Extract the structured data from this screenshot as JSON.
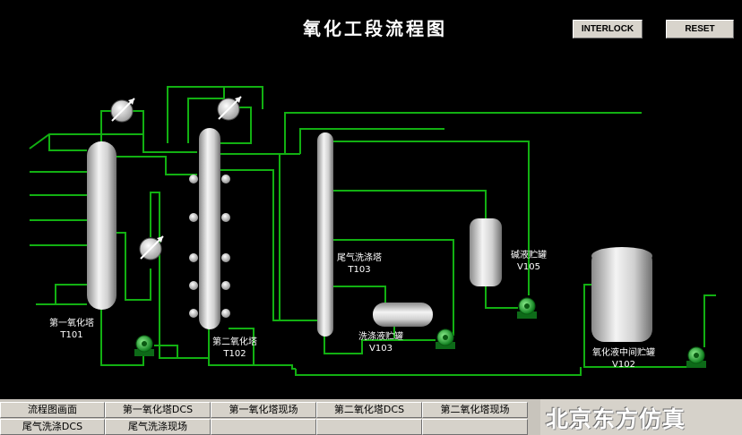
{
  "title": "氧化工段流程图",
  "buttons": {
    "interlock": "INTERLOCK",
    "reset": "RESET"
  },
  "equipment": {
    "t101": {
      "name": "第一氧化塔",
      "tag": "T101"
    },
    "t102": {
      "name": "第二氧化塔",
      "tag": "T102"
    },
    "t103": {
      "name": "尾气洗涤塔",
      "tag": "T103"
    },
    "v103": {
      "name": "洗涤液贮罐",
      "tag": "V103"
    },
    "v105": {
      "name": "碱液贮罐",
      "tag": "V105"
    },
    "v102": {
      "name": "氧化液中间贮罐",
      "tag": "V102"
    }
  },
  "nav": {
    "tabs": [
      "流程图画面",
      "第一氧化塔DCS",
      "第一氧化塔现场",
      "第二氧化塔DCS",
      "第二氧化塔现场",
      "尾气洗涤DCS",
      "尾气洗涤现场"
    ]
  },
  "brand": "北京东方仿真",
  "colors": {
    "pipe": "#12b012",
    "background": "#000000",
    "panel": "#d6d2ca",
    "pump": "#1aa03a"
  }
}
